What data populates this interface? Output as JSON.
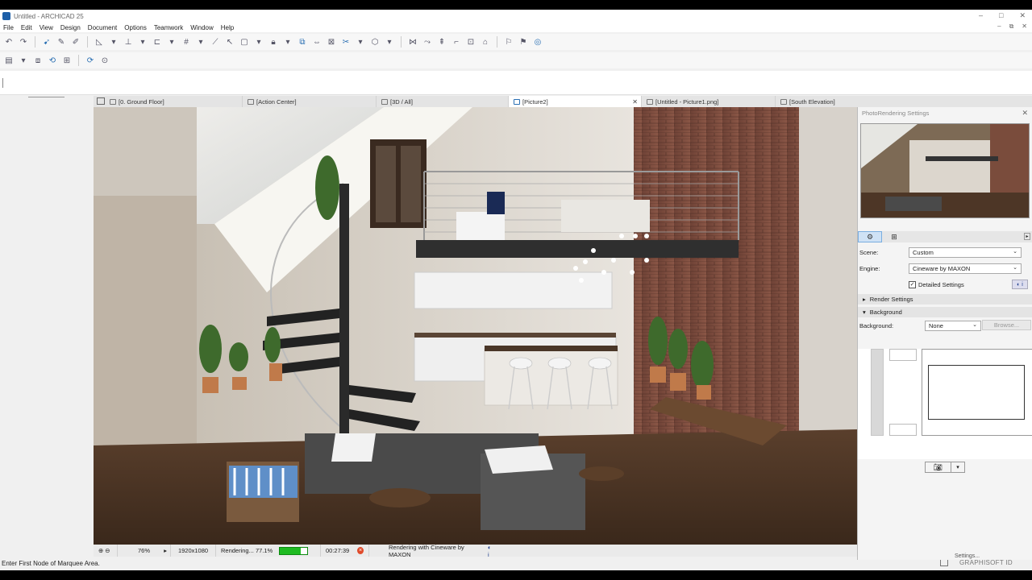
{
  "window": {
    "title": "Untitled - ARCHICAD 25",
    "controls": [
      "–",
      "□",
      "✕"
    ]
  },
  "menu": {
    "items": [
      "File",
      "Edit",
      "View",
      "Design",
      "Document",
      "Options",
      "Teamwork",
      "Window",
      "Help"
    ],
    "doc_controls": [
      "–",
      "⧉",
      "✕"
    ]
  },
  "tabs": [
    {
      "label": "[0. Ground Floor]",
      "icon": "floorplan-icon",
      "active": false
    },
    {
      "label": "[Action Center]",
      "icon": "action-center-icon",
      "active": false
    },
    {
      "label": "[3D / All]",
      "icon": "3d-view-icon",
      "active": false
    },
    {
      "label": "[Picture2]",
      "icon": "picture-icon",
      "active": true
    },
    {
      "label": "[Untitled - Picture1.png]",
      "icon": "image-icon",
      "active": false
    },
    {
      "label": "[South Elevation]",
      "icon": "elevation-icon",
      "active": false
    }
  ],
  "status": {
    "zoom": "76%",
    "resolution": "1920x1080",
    "rendering_text": "Rendering... 77.1%",
    "progress": 0.771,
    "elapsed": "00:27:39",
    "engine_text": "Rendering with Cineware by MAXON"
  },
  "bottom": {
    "message": "Enter First Node of Marquee Area.",
    "graphisoft_id": "GRAPHISOFT ID"
  },
  "palette": {
    "title": "PhotoRendering Settings",
    "scene_label": "Scene:",
    "scene_value": "Custom",
    "engine_label": "Engine:",
    "engine_value": "Cineware by MAXON",
    "detailed_settings": "Detailed Settings",
    "render_settings": "Render Settings",
    "background_section": "Background",
    "background_label": "Background:",
    "background_value": "None",
    "browse": "Browse...",
    "settings_button": "Settings..."
  },
  "colors": {
    "accent": "#2a6fb3",
    "progress": "#1fbb22",
    "stop": "#e04a2a"
  }
}
